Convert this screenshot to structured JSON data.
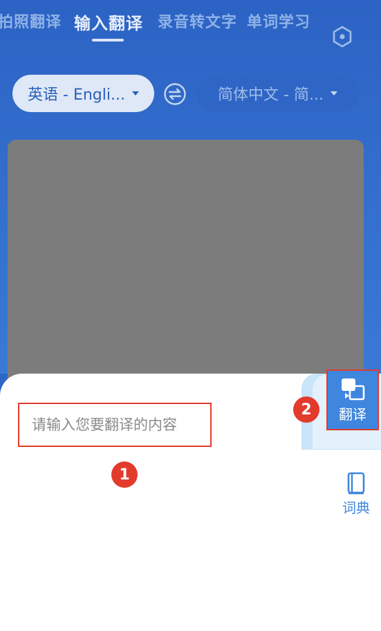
{
  "tabs": [
    {
      "label": "拍照翻译"
    },
    {
      "label": "输入翻译",
      "active": true
    },
    {
      "label": "录音转文字"
    },
    {
      "label": "单词学习"
    }
  ],
  "settings_icon": "settings-hex-icon",
  "source_language": "英语 - Engli...",
  "target_language": "简体中文 - 简...",
  "swap_icon": "swap-arrows-icon",
  "input": {
    "placeholder": "请输入您要翻译的内容",
    "value": ""
  },
  "side_actions": [
    {
      "label": "翻译",
      "icon": "translate-icon"
    },
    {
      "label": "词典",
      "icon": "book-icon"
    }
  ],
  "markers": [
    "1",
    "2"
  ],
  "colors": {
    "header_blue": "#2f66c6",
    "accent_blue": "#3f86df",
    "highlight_red": "#e23b2c"
  }
}
